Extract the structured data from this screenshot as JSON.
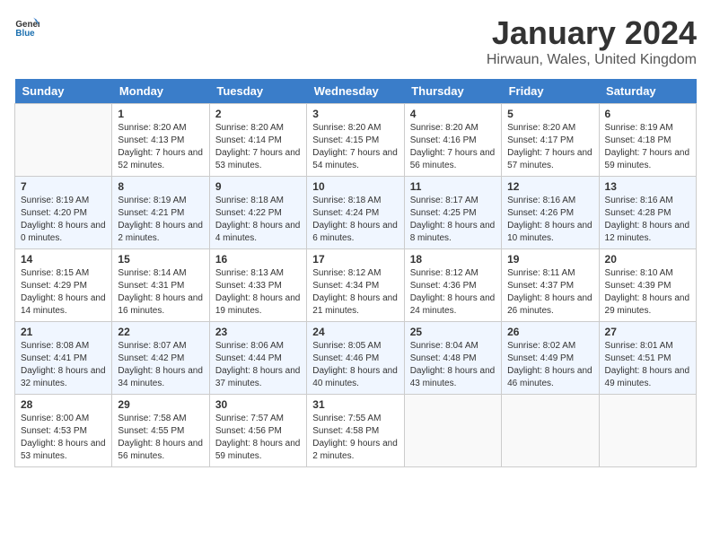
{
  "logo": {
    "text_general": "General",
    "text_blue": "Blue"
  },
  "header": {
    "title": "January 2024",
    "subtitle": "Hirwaun, Wales, United Kingdom"
  },
  "weekdays": [
    "Sunday",
    "Monday",
    "Tuesday",
    "Wednesday",
    "Thursday",
    "Friday",
    "Saturday"
  ],
  "weeks": [
    [
      {
        "day": "",
        "sunrise": "",
        "sunset": "",
        "daylight": ""
      },
      {
        "day": "1",
        "sunrise": "Sunrise: 8:20 AM",
        "sunset": "Sunset: 4:13 PM",
        "daylight": "Daylight: 7 hours and 52 minutes."
      },
      {
        "day": "2",
        "sunrise": "Sunrise: 8:20 AM",
        "sunset": "Sunset: 4:14 PM",
        "daylight": "Daylight: 7 hours and 53 minutes."
      },
      {
        "day": "3",
        "sunrise": "Sunrise: 8:20 AM",
        "sunset": "Sunset: 4:15 PM",
        "daylight": "Daylight: 7 hours and 54 minutes."
      },
      {
        "day": "4",
        "sunrise": "Sunrise: 8:20 AM",
        "sunset": "Sunset: 4:16 PM",
        "daylight": "Daylight: 7 hours and 56 minutes."
      },
      {
        "day": "5",
        "sunrise": "Sunrise: 8:20 AM",
        "sunset": "Sunset: 4:17 PM",
        "daylight": "Daylight: 7 hours and 57 minutes."
      },
      {
        "day": "6",
        "sunrise": "Sunrise: 8:19 AM",
        "sunset": "Sunset: 4:18 PM",
        "daylight": "Daylight: 7 hours and 59 minutes."
      }
    ],
    [
      {
        "day": "7",
        "sunrise": "Sunrise: 8:19 AM",
        "sunset": "Sunset: 4:20 PM",
        "daylight": "Daylight: 8 hours and 0 minutes."
      },
      {
        "day": "8",
        "sunrise": "Sunrise: 8:19 AM",
        "sunset": "Sunset: 4:21 PM",
        "daylight": "Daylight: 8 hours and 2 minutes."
      },
      {
        "day": "9",
        "sunrise": "Sunrise: 8:18 AM",
        "sunset": "Sunset: 4:22 PM",
        "daylight": "Daylight: 8 hours and 4 minutes."
      },
      {
        "day": "10",
        "sunrise": "Sunrise: 8:18 AM",
        "sunset": "Sunset: 4:24 PM",
        "daylight": "Daylight: 8 hours and 6 minutes."
      },
      {
        "day": "11",
        "sunrise": "Sunrise: 8:17 AM",
        "sunset": "Sunset: 4:25 PM",
        "daylight": "Daylight: 8 hours and 8 minutes."
      },
      {
        "day": "12",
        "sunrise": "Sunrise: 8:16 AM",
        "sunset": "Sunset: 4:26 PM",
        "daylight": "Daylight: 8 hours and 10 minutes."
      },
      {
        "day": "13",
        "sunrise": "Sunrise: 8:16 AM",
        "sunset": "Sunset: 4:28 PM",
        "daylight": "Daylight: 8 hours and 12 minutes."
      }
    ],
    [
      {
        "day": "14",
        "sunrise": "Sunrise: 8:15 AM",
        "sunset": "Sunset: 4:29 PM",
        "daylight": "Daylight: 8 hours and 14 minutes."
      },
      {
        "day": "15",
        "sunrise": "Sunrise: 8:14 AM",
        "sunset": "Sunset: 4:31 PM",
        "daylight": "Daylight: 8 hours and 16 minutes."
      },
      {
        "day": "16",
        "sunrise": "Sunrise: 8:13 AM",
        "sunset": "Sunset: 4:33 PM",
        "daylight": "Daylight: 8 hours and 19 minutes."
      },
      {
        "day": "17",
        "sunrise": "Sunrise: 8:12 AM",
        "sunset": "Sunset: 4:34 PM",
        "daylight": "Daylight: 8 hours and 21 minutes."
      },
      {
        "day": "18",
        "sunrise": "Sunrise: 8:12 AM",
        "sunset": "Sunset: 4:36 PM",
        "daylight": "Daylight: 8 hours and 24 minutes."
      },
      {
        "day": "19",
        "sunrise": "Sunrise: 8:11 AM",
        "sunset": "Sunset: 4:37 PM",
        "daylight": "Daylight: 8 hours and 26 minutes."
      },
      {
        "day": "20",
        "sunrise": "Sunrise: 8:10 AM",
        "sunset": "Sunset: 4:39 PM",
        "daylight": "Daylight: 8 hours and 29 minutes."
      }
    ],
    [
      {
        "day": "21",
        "sunrise": "Sunrise: 8:08 AM",
        "sunset": "Sunset: 4:41 PM",
        "daylight": "Daylight: 8 hours and 32 minutes."
      },
      {
        "day": "22",
        "sunrise": "Sunrise: 8:07 AM",
        "sunset": "Sunset: 4:42 PM",
        "daylight": "Daylight: 8 hours and 34 minutes."
      },
      {
        "day": "23",
        "sunrise": "Sunrise: 8:06 AM",
        "sunset": "Sunset: 4:44 PM",
        "daylight": "Daylight: 8 hours and 37 minutes."
      },
      {
        "day": "24",
        "sunrise": "Sunrise: 8:05 AM",
        "sunset": "Sunset: 4:46 PM",
        "daylight": "Daylight: 8 hours and 40 minutes."
      },
      {
        "day": "25",
        "sunrise": "Sunrise: 8:04 AM",
        "sunset": "Sunset: 4:48 PM",
        "daylight": "Daylight: 8 hours and 43 minutes."
      },
      {
        "day": "26",
        "sunrise": "Sunrise: 8:02 AM",
        "sunset": "Sunset: 4:49 PM",
        "daylight": "Daylight: 8 hours and 46 minutes."
      },
      {
        "day": "27",
        "sunrise": "Sunrise: 8:01 AM",
        "sunset": "Sunset: 4:51 PM",
        "daylight": "Daylight: 8 hours and 49 minutes."
      }
    ],
    [
      {
        "day": "28",
        "sunrise": "Sunrise: 8:00 AM",
        "sunset": "Sunset: 4:53 PM",
        "daylight": "Daylight: 8 hours and 53 minutes."
      },
      {
        "day": "29",
        "sunrise": "Sunrise: 7:58 AM",
        "sunset": "Sunset: 4:55 PM",
        "daylight": "Daylight: 8 hours and 56 minutes."
      },
      {
        "day": "30",
        "sunrise": "Sunrise: 7:57 AM",
        "sunset": "Sunset: 4:56 PM",
        "daylight": "Daylight: 8 hours and 59 minutes."
      },
      {
        "day": "31",
        "sunrise": "Sunrise: 7:55 AM",
        "sunset": "Sunset: 4:58 PM",
        "daylight": "Daylight: 9 hours and 2 minutes."
      },
      {
        "day": "",
        "sunrise": "",
        "sunset": "",
        "daylight": ""
      },
      {
        "day": "",
        "sunrise": "",
        "sunset": "",
        "daylight": ""
      },
      {
        "day": "",
        "sunrise": "",
        "sunset": "",
        "daylight": ""
      }
    ]
  ]
}
